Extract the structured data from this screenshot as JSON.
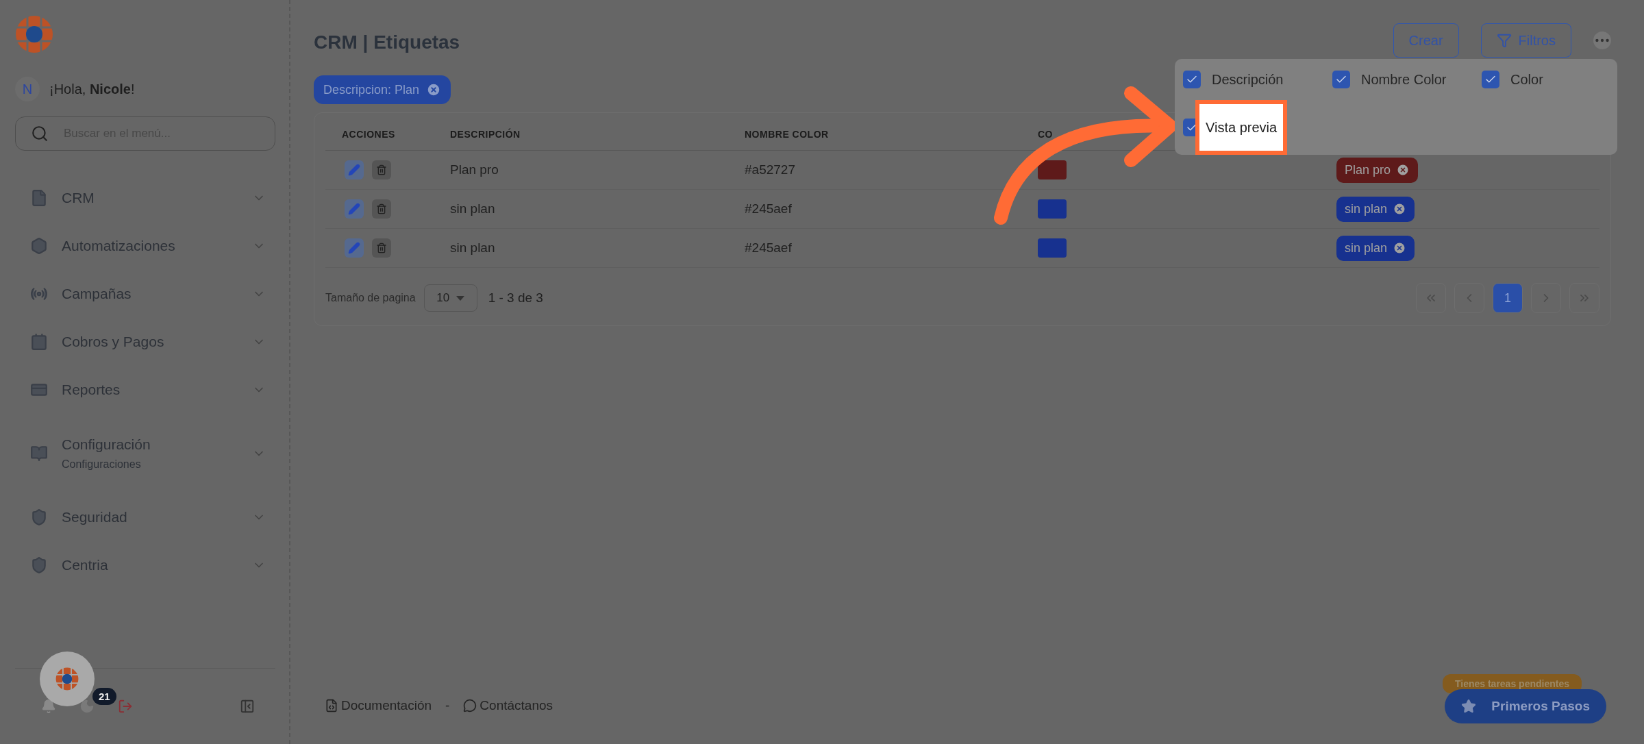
{
  "sidebar": {
    "user": {
      "initial": "N",
      "greeting": "¡Hola, **Nicole**!"
    },
    "search": {
      "placeholder": "Buscar en el menú..."
    },
    "items": [
      {
        "label": "CRM"
      },
      {
        "label": "Automatizaciones"
      },
      {
        "label": "Campañas"
      },
      {
        "label": "Cobros y Pagos"
      },
      {
        "label": "Reportes"
      },
      {
        "label": "Configuración",
        "sublabel": "Configuraciones"
      },
      {
        "label": "Seguridad"
      },
      {
        "label": "Centria"
      }
    ],
    "notification_count": "21"
  },
  "header": {
    "title": "CRM | Etiquetas",
    "buttons": [
      {
        "label": "Crear",
        "kind": "plain"
      },
      {
        "label": "Filtros",
        "kind": "filter"
      }
    ]
  },
  "filter_chips": [
    {
      "label": "Descripcion: Plan"
    }
  ],
  "table": {
    "columns": [
      "ACCIONES",
      "DESCRIPCIÓN",
      "NOMBRE COLOR",
      "CO"
    ],
    "rows": [
      {
        "description": "Plan pro",
        "color_name": "#a52727",
        "color": "#5e1a1a",
        "preview": "Plan pro"
      },
      {
        "description": "sin plan",
        "color_name": "#245aef",
        "color": "#17318f",
        "preview": "sin plan"
      },
      {
        "description": "sin plan",
        "color_name": "#245aef",
        "color": "#17318f",
        "preview": "sin plan"
      }
    ]
  },
  "pagination": {
    "label": "Tamaño de pagina",
    "page_size": "10",
    "range": "1 - 3 de 3",
    "pages": [
      {
        "label": "1",
        "selected": true
      }
    ]
  },
  "column_menu": {
    "options": [
      {
        "label": "Descripción",
        "checked": true,
        "highlighted": false
      },
      {
        "label": "Nombre Color",
        "checked": true,
        "highlighted": false
      },
      {
        "label": "Color",
        "checked": true,
        "highlighted": false
      },
      {
        "label": "Vista previa",
        "checked": true,
        "highlighted": true
      }
    ]
  },
  "footer": {
    "links": [
      {
        "label": "Documentación",
        "kind": "docs"
      },
      {
        "label": "Contáctanos",
        "kind": "chat"
      }
    ],
    "separator": "-"
  },
  "tasks": {
    "badge": "Tienes tareas pendientes",
    "button": "Primeros Pasos"
  }
}
